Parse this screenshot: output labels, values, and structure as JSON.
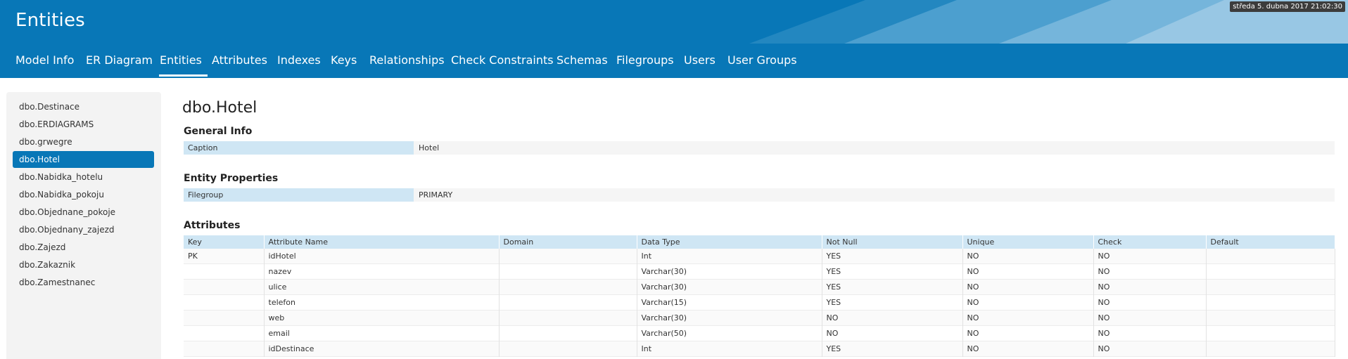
{
  "header": {
    "title": "Entities",
    "datetime": "středa 5. dubna 2017 21:02:30"
  },
  "nav": {
    "items": [
      "Model Info",
      "ER Diagram",
      "Entities",
      "Attributes",
      "Indexes",
      "Keys",
      "Relationships",
      "Check Constraints",
      "Schemas",
      "Filegroups",
      "Users",
      "User Groups"
    ],
    "active": "Entities"
  },
  "sidebar": {
    "items": [
      "dbo.Destinace",
      "dbo.ERDIAGRAMS",
      "dbo.grwegre",
      "dbo.Hotel",
      "dbo.Nabidka_hotelu",
      "dbo.Nabidka_pokoju",
      "dbo.Objednane_pokoje",
      "dbo.Objednany_zajezd",
      "dbo.Zajezd",
      "dbo.Zakaznik",
      "dbo.Zamestnanec"
    ],
    "active": "dbo.Hotel"
  },
  "entity": {
    "name": "dbo.Hotel",
    "general_info": {
      "title": "General Info",
      "caption_label": "Caption",
      "caption_value": "Hotel"
    },
    "entity_properties": {
      "title": "Entity Properties",
      "filegroup_label": "Filegroup",
      "filegroup_value": "PRIMARY"
    },
    "attributes": {
      "title": "Attributes",
      "columns": [
        "Key",
        "Attribute Name",
        "Domain",
        "Data Type",
        "Not Null",
        "Unique",
        "Check",
        "Default"
      ],
      "rows": [
        [
          "PK",
          "idHotel",
          "",
          "Int",
          "YES",
          "NO",
          "NO",
          ""
        ],
        [
          "",
          "nazev",
          "",
          "Varchar(30)",
          "YES",
          "NO",
          "NO",
          ""
        ],
        [
          "",
          "ulice",
          "",
          "Varchar(30)",
          "YES",
          "NO",
          "NO",
          ""
        ],
        [
          "",
          "telefon",
          "",
          "Varchar(15)",
          "YES",
          "NO",
          "NO",
          ""
        ],
        [
          "",
          "web",
          "",
          "Varchar(30)",
          "NO",
          "NO",
          "NO",
          ""
        ],
        [
          "",
          "email",
          "",
          "Varchar(50)",
          "NO",
          "NO",
          "NO",
          ""
        ],
        [
          "",
          "idDestinace",
          "",
          "Int",
          "YES",
          "NO",
          "NO",
          ""
        ]
      ]
    }
  },
  "colors": {
    "brand": "#0877b7",
    "label_bg": "#cfe6f4",
    "sidebar_bg": "#f3f3f3"
  }
}
